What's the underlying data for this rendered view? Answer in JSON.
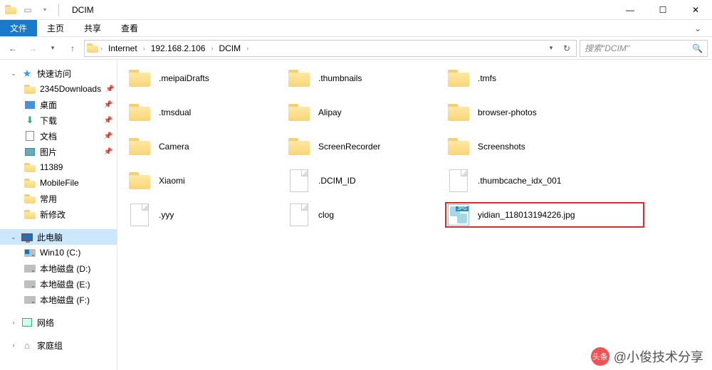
{
  "window": {
    "title": "DCIM"
  },
  "ribbon": {
    "file": "文件",
    "tabs": [
      "主页",
      "共享",
      "查看"
    ]
  },
  "breadcrumbs": {
    "segments": [
      "Internet",
      "192.168.2.106",
      "DCIM"
    ]
  },
  "search": {
    "placeholder": "搜索\"DCIM\""
  },
  "sidebar": {
    "quick_access": "快速访问",
    "items": [
      {
        "label": "2345Downloads",
        "pinned": true,
        "icon": "folder"
      },
      {
        "label": "桌面",
        "pinned": true,
        "icon": "desktop"
      },
      {
        "label": "下载",
        "pinned": true,
        "icon": "downloads"
      },
      {
        "label": "文档",
        "pinned": true,
        "icon": "documents"
      },
      {
        "label": "图片",
        "pinned": true,
        "icon": "pictures"
      },
      {
        "label": "11389",
        "pinned": false,
        "icon": "folder"
      },
      {
        "label": "MobileFile",
        "pinned": false,
        "icon": "folder"
      },
      {
        "label": "常用",
        "pinned": false,
        "icon": "folder"
      },
      {
        "label": "新修改",
        "pinned": false,
        "icon": "folder"
      }
    ],
    "this_pc": "此电脑",
    "drives": [
      {
        "label": "Win10 (C:)",
        "icon": "windisk"
      },
      {
        "label": "本地磁盘 (D:)",
        "icon": "disk"
      },
      {
        "label": "本地磁盘 (E:)",
        "icon": "disk"
      },
      {
        "label": "本地磁盘 (F:)",
        "icon": "disk"
      }
    ],
    "network": "网络",
    "homegroup": "家庭组"
  },
  "files": [
    {
      "name": ".meipaiDrafts",
      "type": "folder"
    },
    {
      "name": ".thumbnails",
      "type": "folder"
    },
    {
      "name": ".tmfs",
      "type": "folder"
    },
    {
      "name": ".tmsdual",
      "type": "folder"
    },
    {
      "name": "Alipay",
      "type": "folder"
    },
    {
      "name": "browser-photos",
      "type": "folder"
    },
    {
      "name": "Camera",
      "type": "folder"
    },
    {
      "name": "ScreenRecorder",
      "type": "folder"
    },
    {
      "name": "Screenshots",
      "type": "folder"
    },
    {
      "name": "Xiaomi",
      "type": "folder"
    },
    {
      "name": ".DCIM_ID",
      "type": "file"
    },
    {
      "name": ".thumbcache_idx_001",
      "type": "file"
    },
    {
      "name": ".yyy",
      "type": "file"
    },
    {
      "name": "clog",
      "type": "file"
    },
    {
      "name": "yidian_118013194226.jpg",
      "type": "jpg",
      "highlight": true
    }
  ],
  "watermark": {
    "logo_text": "头条",
    "text": "@小俊技术分享"
  }
}
